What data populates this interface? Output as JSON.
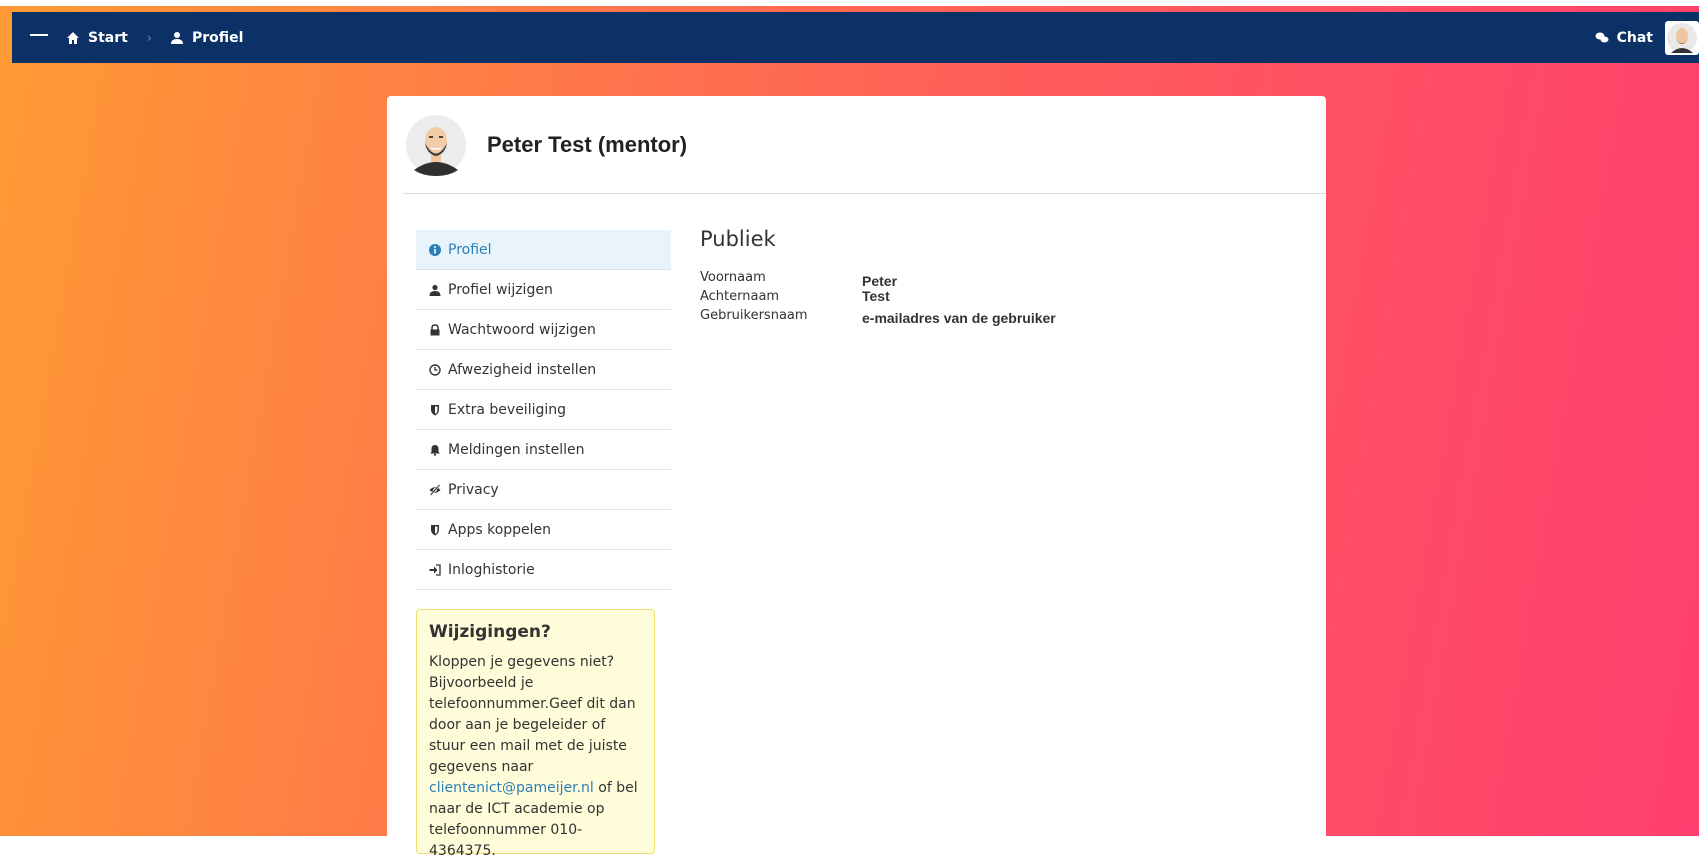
{
  "topbar": {
    "breadcrumb_start": "Start",
    "breadcrumb_profile": "Profiel",
    "chat_label": "Chat",
    "bg_color": "#0b3167"
  },
  "profile": {
    "display_name": "Peter Test (mentor)"
  },
  "menu": {
    "items": [
      {
        "label": "Profiel",
        "icon": "info-icon",
        "active": true
      },
      {
        "label": "Profiel wijzigen",
        "icon": "user-icon"
      },
      {
        "label": "Wachtwoord wijzigen",
        "icon": "lock-icon"
      },
      {
        "label": "Afwezigheid instellen",
        "icon": "clock-icon"
      },
      {
        "label": "Extra beveiliging",
        "icon": "shield-icon"
      },
      {
        "label": "Meldingen instellen",
        "icon": "bell-icon"
      },
      {
        "label": "Privacy",
        "icon": "eye-slash-icon"
      },
      {
        "label": "Apps koppelen",
        "icon": "shield-icon"
      },
      {
        "label": "Inloghistorie",
        "icon": "sign-in-icon"
      }
    ]
  },
  "notice": {
    "title": "Wijzigingen?",
    "text_before": "Kloppen je gegevens niet? Bijvoorbeeld je telefoonnummer.",
    "text_middle": "Geef dit dan door aan je begeleider of stuur een mail met de juiste gegevens naar ",
    "email": "clientenict@pameijer.nl",
    "text_after": " of bel naar de ICT academie op telefoonnummer 010-4364375."
  },
  "public": {
    "title": "Publiek",
    "fields": [
      {
        "label": "Voornaam",
        "value": "Peter"
      },
      {
        "label": "Achternaam",
        "value": "Test"
      },
      {
        "label": "Gebruikersnaam",
        "value": "e-mailadres van de gebruiker"
      }
    ]
  },
  "colors": {
    "accent": "#2d7fb8",
    "gradient_start": "#ff9a34",
    "gradient_end": "#ff3f6f"
  }
}
